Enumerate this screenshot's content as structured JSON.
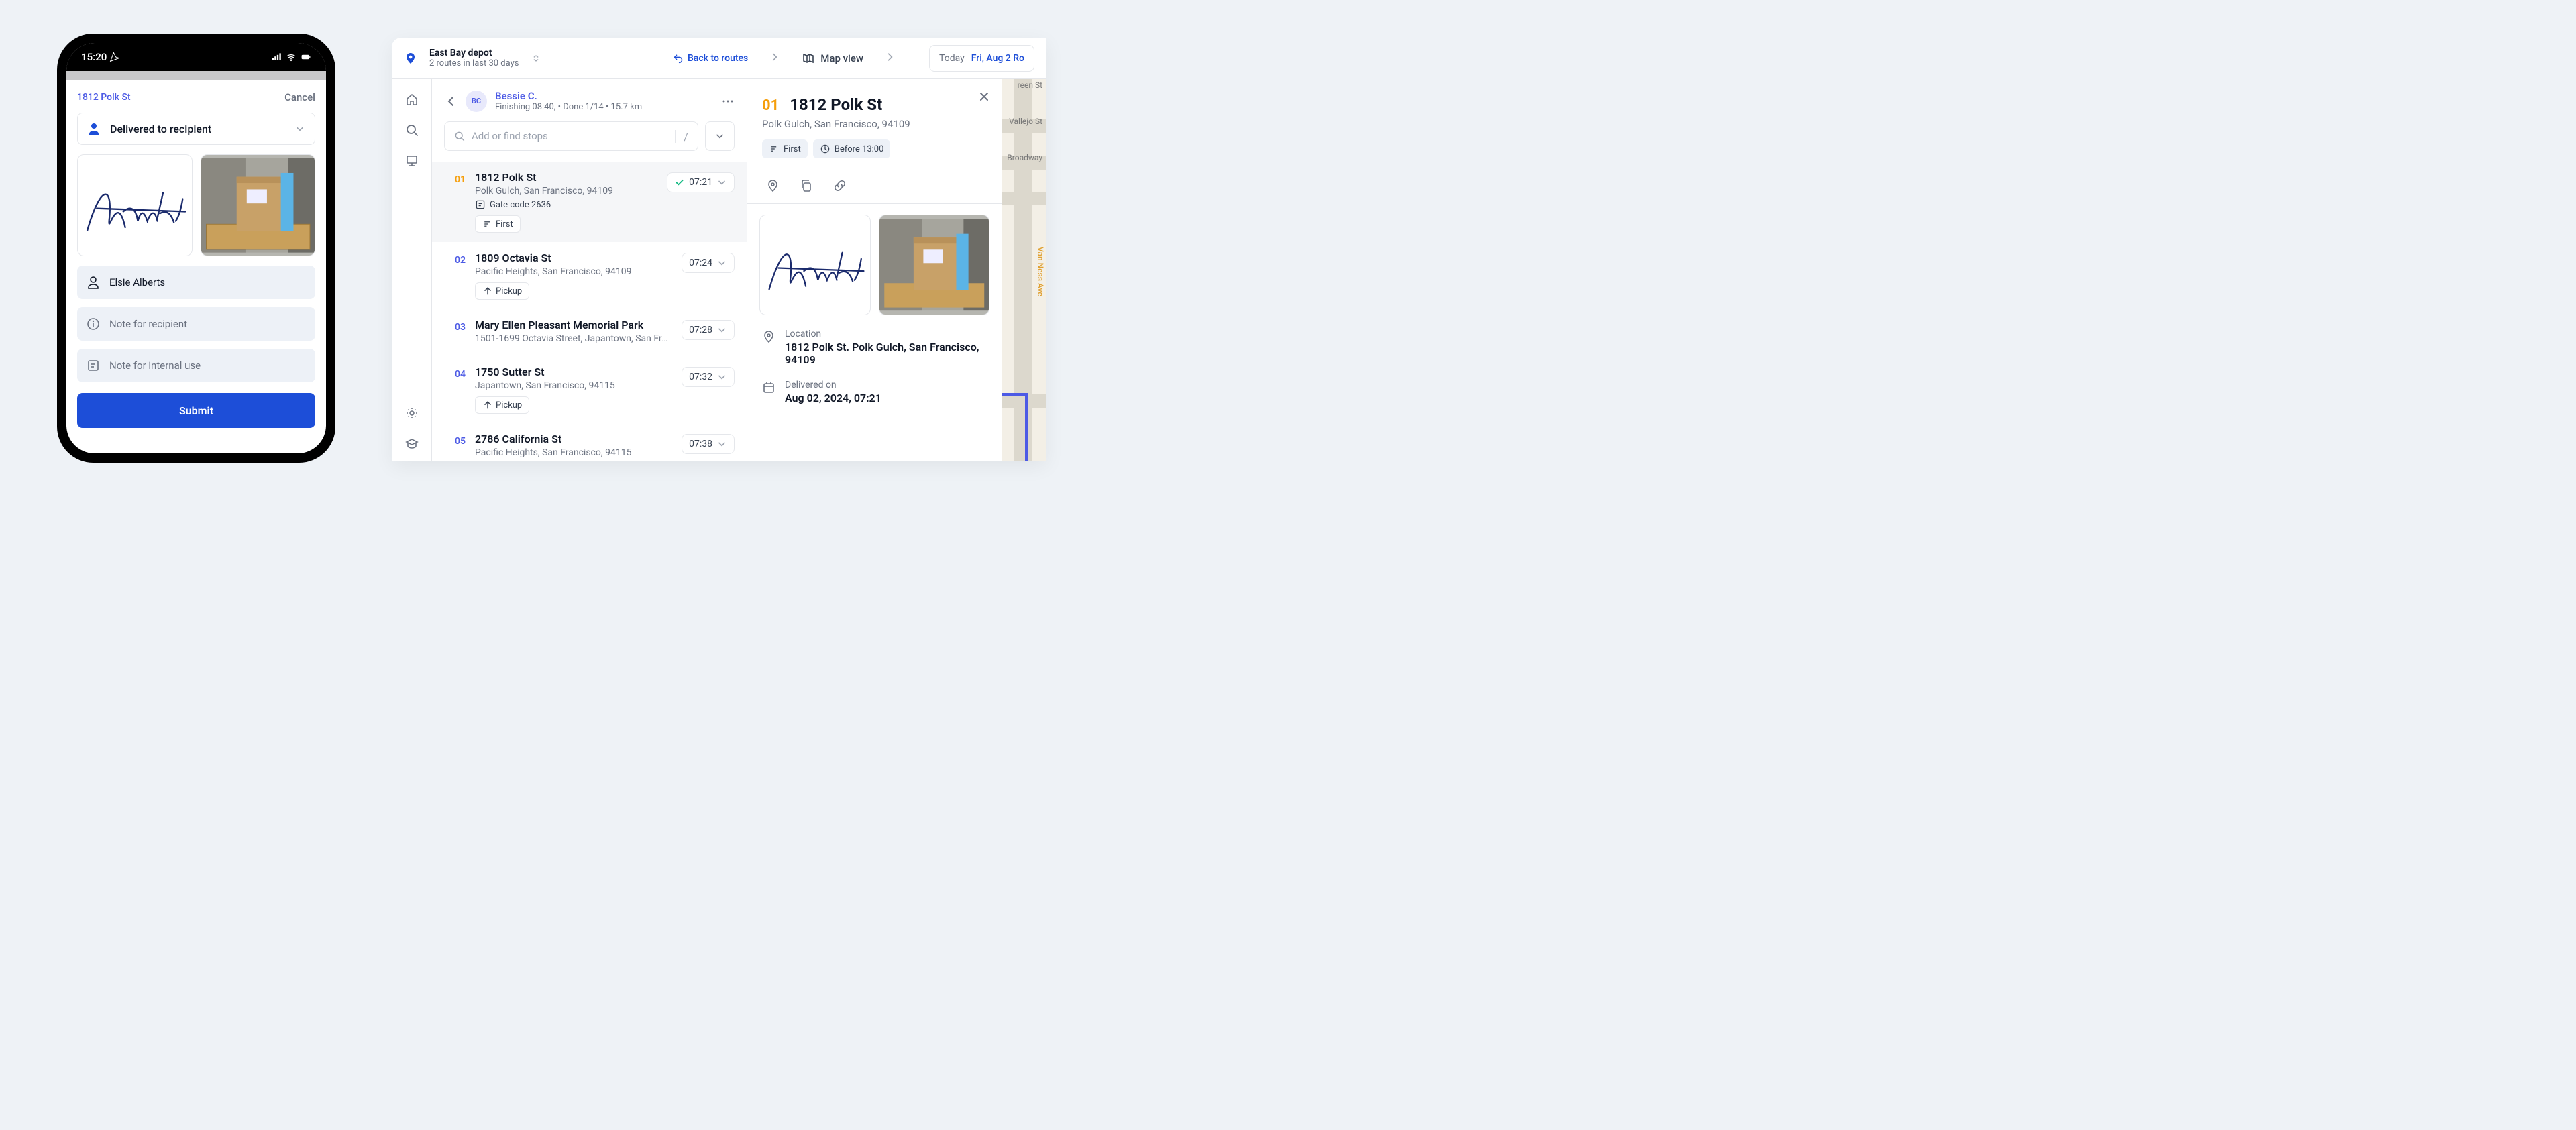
{
  "phone": {
    "time": "15:20",
    "address": "1812 Polk St",
    "cancel_label": "Cancel",
    "status_label": "Delivered to recipient",
    "recipient_name": "Elsie Alberts",
    "note_recipient_ph": "Note for recipient",
    "note_internal_ph": "Note for internal use",
    "submit_label": "Submit",
    "signature_text": "Alberts"
  },
  "topbar": {
    "depot_name": "East Bay depot",
    "depot_sub": "2 routes in last 30 days",
    "back_label": "Back to routes",
    "map_view_label": "Map view",
    "today_label": "Today",
    "date_label": "Fri, Aug 2 Ro"
  },
  "driver": {
    "initials": "BC",
    "name": "Bessie C.",
    "sub": "Finishing 08:40, • Done 1/14 • 15.7 km",
    "search_ph": "Add or find stops",
    "slash_hint": "/"
  },
  "stops": [
    {
      "num": "01",
      "num_class": "orange",
      "title": "1812 Polk St",
      "addr": "Polk Gulch, San Francisco, 94109",
      "note": "Gate code 2636",
      "tags": [
        "First"
      ],
      "time": "07:21",
      "done": true
    },
    {
      "num": "02",
      "num_class": "",
      "title": "1809 Octavia St",
      "addr": "Pacific Heights, San Francisco, 94109",
      "note": "",
      "tags": [
        "Pickup"
      ],
      "time": "07:24",
      "done": false,
      "pickup": true
    },
    {
      "num": "03",
      "num_class": "",
      "title": "Mary Ellen Pleasant Memorial Park",
      "addr": "1501-1699 Octavia Street, Japantown, San Franci…",
      "note": "",
      "tags": [],
      "time": "07:28",
      "done": false
    },
    {
      "num": "04",
      "num_class": "",
      "title": "1750 Sutter St",
      "addr": "Japantown, San Francisco, 94115",
      "note": "",
      "tags": [
        "Pickup"
      ],
      "time": "07:32",
      "done": false,
      "pickup": true
    },
    {
      "num": "05",
      "num_class": "",
      "title": "2786 California St",
      "addr": "Pacific Heights, San Francisco, 94115",
      "note": "",
      "tags": [],
      "time": "07:38",
      "done": false
    }
  ],
  "detail": {
    "num": "01",
    "title": "1812 Polk St",
    "sub": "Polk Gulch, San Francisco, 94109",
    "chip_first": "First",
    "chip_time": "Before 13:00",
    "location_label": "Location",
    "location_value": "1812 Polk St. Polk Gulch, San Francisco, 94109",
    "delivered_label": "Delivered on",
    "delivered_value": "Aug 02, 2024, 07:21"
  },
  "map": {
    "labels": [
      "reen St",
      "Vallejo St",
      "Broadway",
      "Van Ness Ave"
    ]
  }
}
